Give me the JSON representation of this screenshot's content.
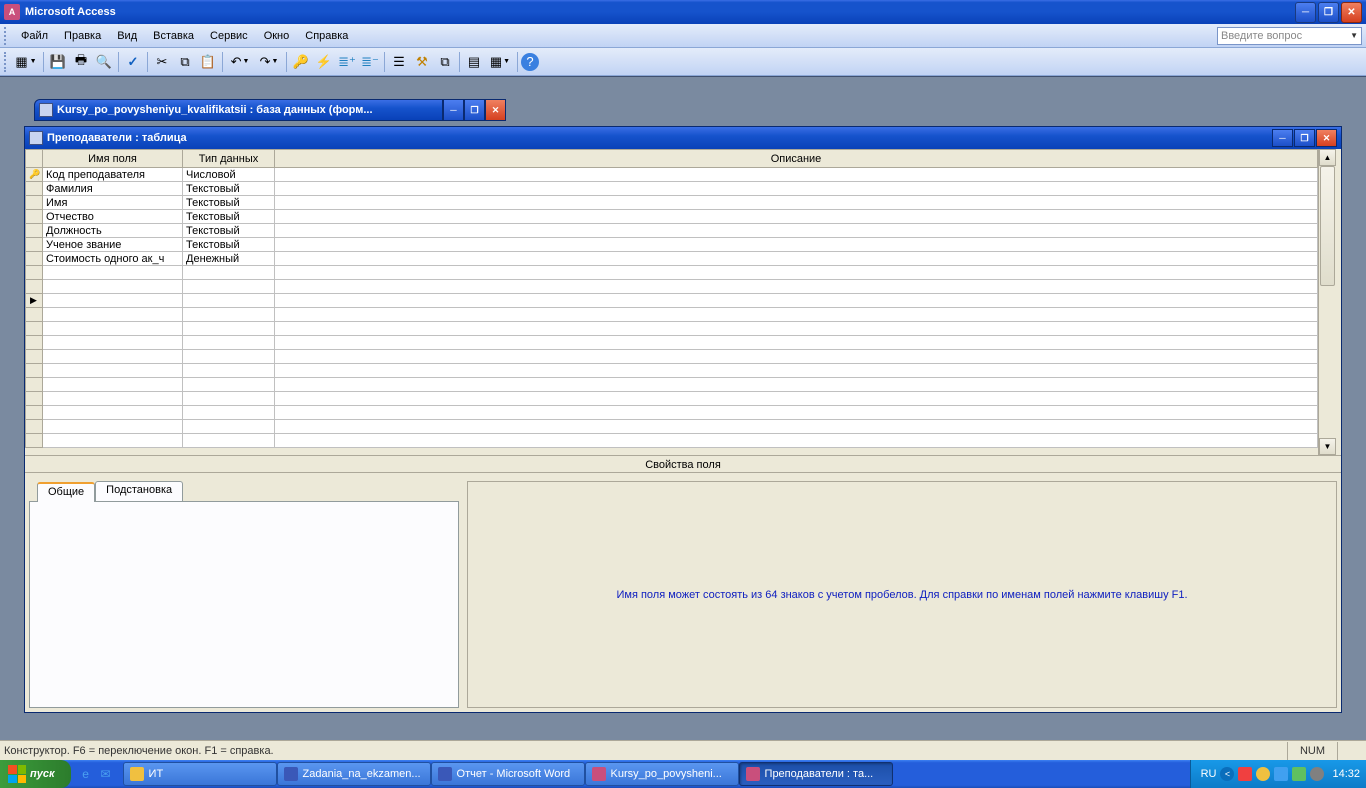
{
  "app": {
    "title": "Microsoft Access"
  },
  "menu": {
    "file": "Файл",
    "edit": "Правка",
    "view": "Вид",
    "insert": "Вставка",
    "service": "Сервис",
    "window": "Окно",
    "help": "Справка",
    "question_placeholder": "Введите вопрос"
  },
  "dbwin": {
    "title": "Kursy_po_povysheniyu_kvalifikatsii : база данных (форм..."
  },
  "tablewin": {
    "title": "Преподаватели : таблица"
  },
  "grid": {
    "headers": {
      "name": "Имя поля",
      "type": "Тип данных",
      "desc": "Описание"
    },
    "rows": [
      {
        "pk": true,
        "name": "Код преподавателя",
        "type": "Числовой",
        "desc": ""
      },
      {
        "pk": false,
        "name": "Фамилия",
        "type": "Текстовый",
        "desc": ""
      },
      {
        "pk": false,
        "name": "Имя",
        "type": "Текстовый",
        "desc": ""
      },
      {
        "pk": false,
        "name": "Отчество",
        "type": "Текстовый",
        "desc": ""
      },
      {
        "pk": false,
        "name": "Должность",
        "type": "Текстовый",
        "desc": ""
      },
      {
        "pk": false,
        "name": "Ученое звание",
        "type": "Текстовый",
        "desc": ""
      },
      {
        "pk": false,
        "name": "Стоимость одного ак_ч",
        "type": "Денежный",
        "desc": ""
      }
    ]
  },
  "props": {
    "pane_title": "Свойства поля",
    "tab_general": "Общие",
    "tab_lookup": "Подстановка",
    "hint": "Имя поля может состоять из 64 знаков с учетом пробелов.  Для справки по именам полей нажмите клавишу F1."
  },
  "status": {
    "text": "Конструктор.  F6 = переключение окон.  F1 = справка.",
    "num": "NUM"
  },
  "taskbar": {
    "start": "пуск",
    "items": [
      {
        "label": "ИТ",
        "color": "#f0c040"
      },
      {
        "label": "Zadania_na_ekzamen...",
        "color": "#3a58b8"
      },
      {
        "label": "Отчет - Microsoft Word",
        "color": "#3a58b8"
      },
      {
        "label": "Kursy_po_povysheni...",
        "color": "#c94f7c"
      },
      {
        "label": "Преподаватели : та...",
        "color": "#c94f7c",
        "active": true
      }
    ],
    "lang": "RU",
    "clock": "14:32"
  }
}
